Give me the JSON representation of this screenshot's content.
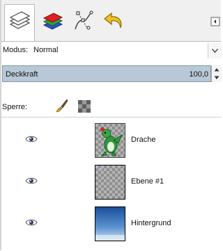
{
  "tabs": [
    {
      "name": "layers-icon",
      "active": true
    },
    {
      "name": "channels-icon",
      "active": false
    },
    {
      "name": "paths-icon",
      "active": false
    },
    {
      "name": "undo-history-icon",
      "active": false
    }
  ],
  "mode": {
    "label": "Modus:",
    "value": "Normal"
  },
  "opacity": {
    "label": "Deckkraft",
    "value": "100,0"
  },
  "lock": {
    "label": "Sperre:"
  },
  "layers": [
    {
      "name": "Drache",
      "visible": true,
      "thumb": "dragon-thumbnail"
    },
    {
      "name": "Ebene #1",
      "visible": true,
      "thumb": "checker-thumbnail"
    },
    {
      "name": "Hintergrund",
      "visible": true,
      "thumb": "gradient-thumbnail"
    }
  ],
  "colors": {
    "opacity_fill": "#b8c8d6",
    "opacity_border": "#8496a6"
  }
}
